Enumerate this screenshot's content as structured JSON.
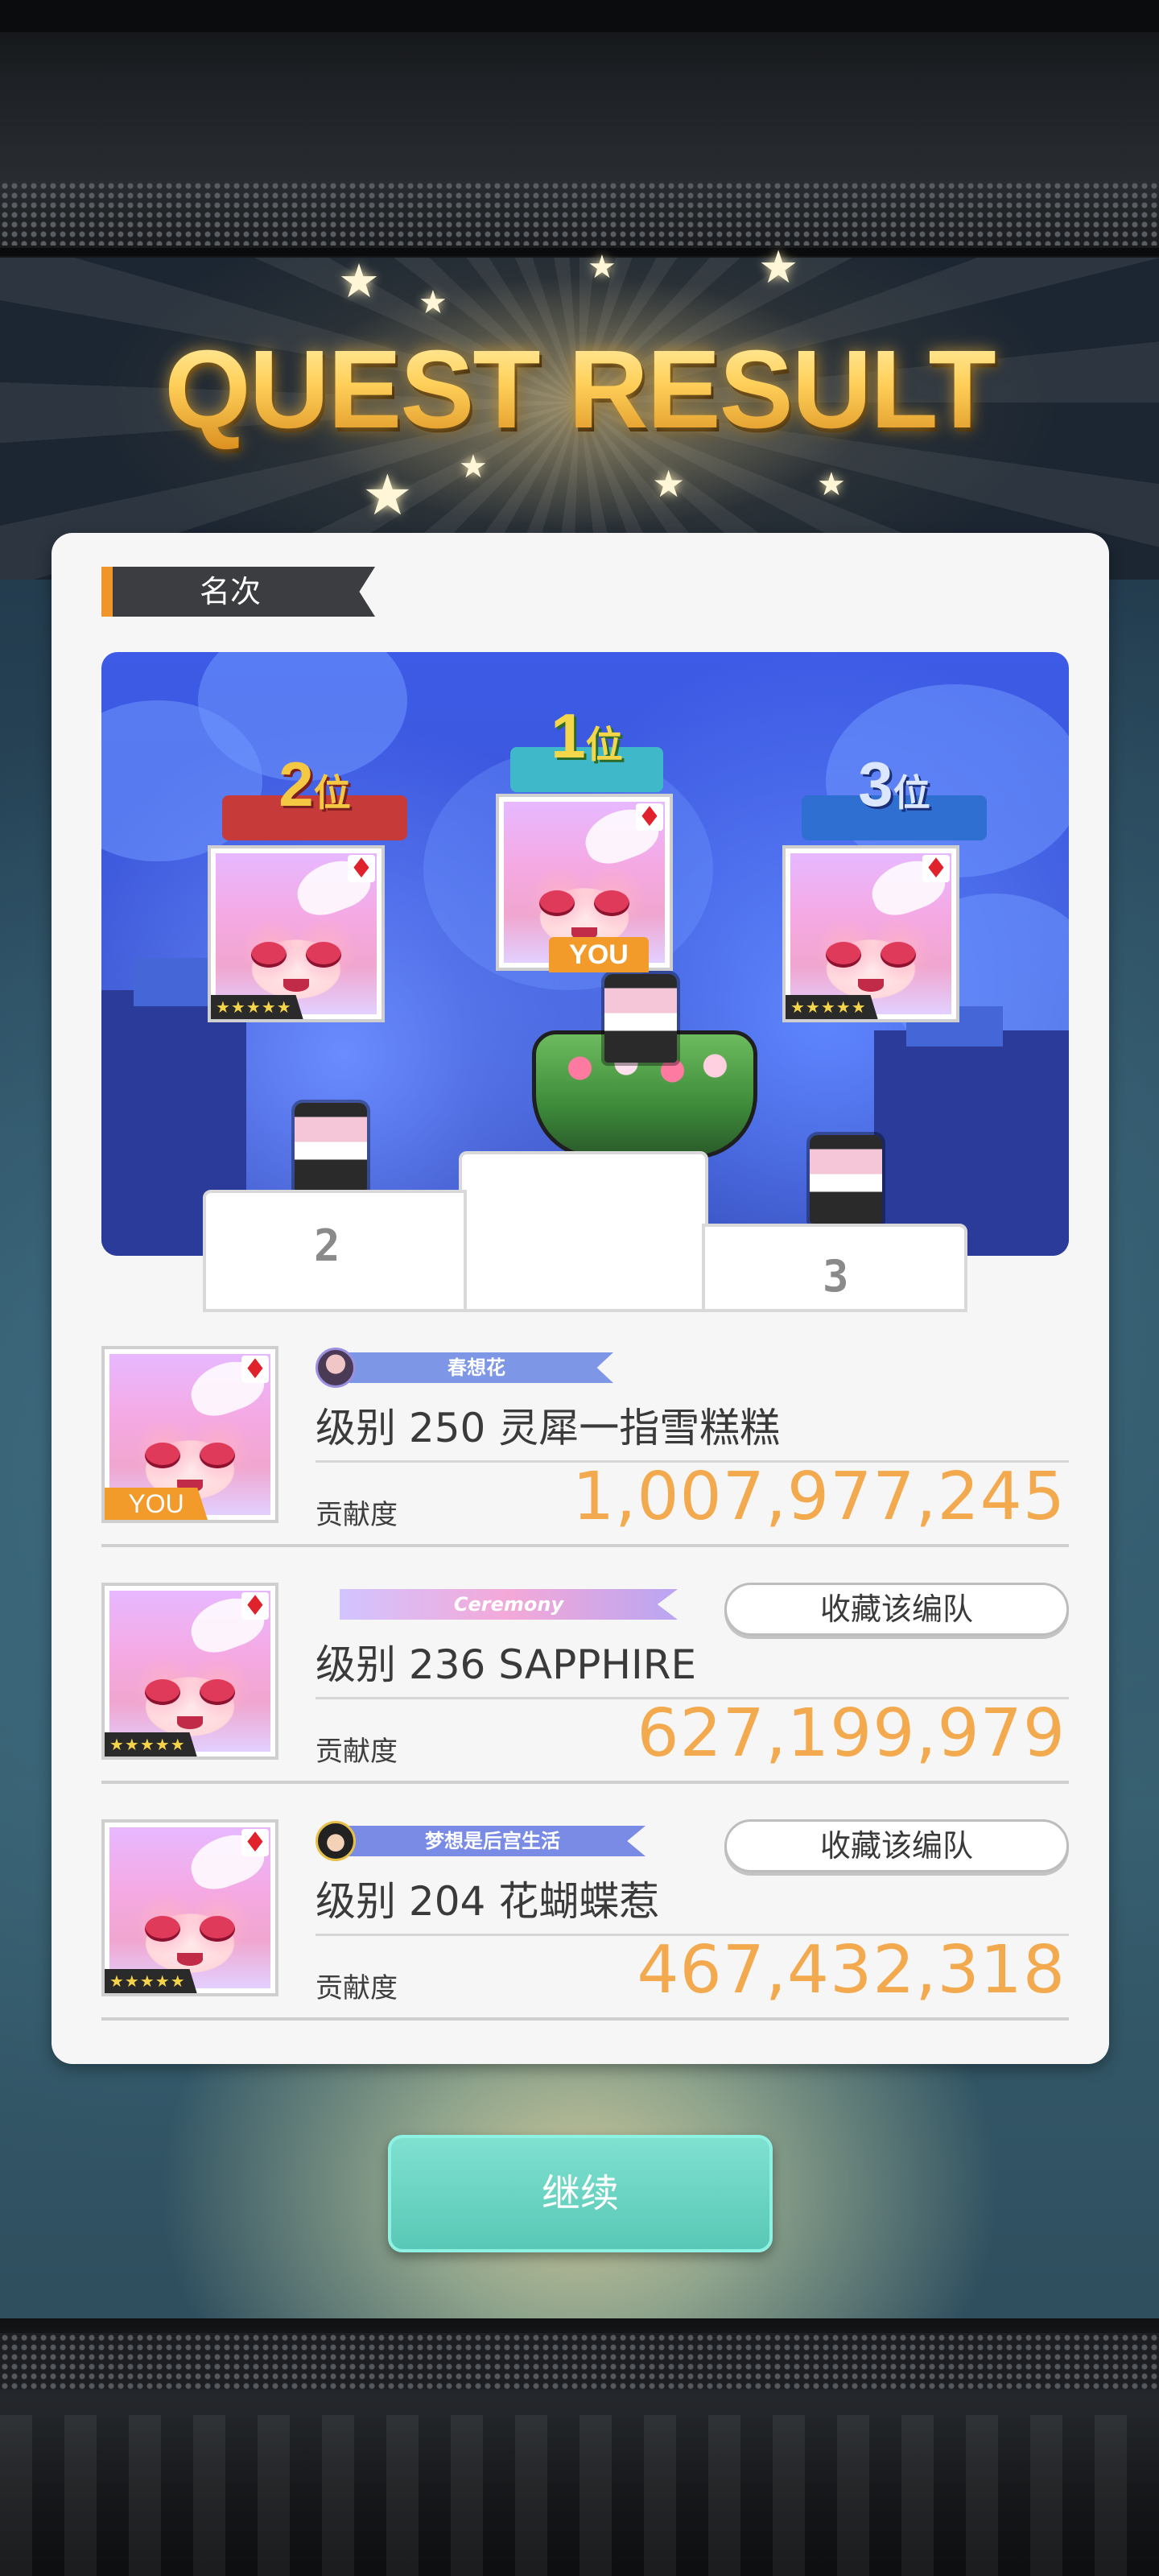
{
  "title": "QUEST RESULT",
  "section_label": "名次",
  "podium": {
    "places": [
      {
        "rank_number": "1",
        "rank_suffix": "位",
        "ribbon_color": "#3fb8c9",
        "you": "YOU"
      },
      {
        "rank_number": "2",
        "rank_suffix": "位",
        "ribbon_color": "#c73a3a",
        "rarity": "★★★★★"
      },
      {
        "rank_number": "3",
        "rank_suffix": "位",
        "ribbon_color": "#2f6fd1",
        "rarity": "★★★★★"
      }
    ],
    "step_labels": [
      "2",
      "3"
    ]
  },
  "rankings": [
    {
      "badge_text": "春想花",
      "badge_color": "#7e96e6",
      "name": "级别 250 灵犀一指雪糕糕",
      "contrib_label": "贡献度",
      "score": "1,007,977,245",
      "you": "YOU"
    },
    {
      "badge_text": "Ceremony",
      "badge_color": "#b9a6f2",
      "name": "级别 236 SAPPHIRE",
      "contrib_label": "贡献度",
      "score": "627,199,979",
      "fav_label": "收藏该编队",
      "rarity": "★★★★★"
    },
    {
      "badge_text": "梦想是后宫生活",
      "badge_color": "#7a8be6",
      "name": "级别 204  花蝴蝶惹",
      "contrib_label": "贡献度",
      "score": "467,432,318",
      "fav_label": "收藏该编队",
      "rarity": "★★★★★"
    }
  ],
  "continue_label": "继续",
  "colors": {
    "accent_orange": "#f3a94d",
    "continue_teal": "#59c8b6",
    "suit_red": "#e0222c"
  },
  "icons": {
    "suit": "diamond-suit-icon",
    "stars": "star-icon"
  }
}
